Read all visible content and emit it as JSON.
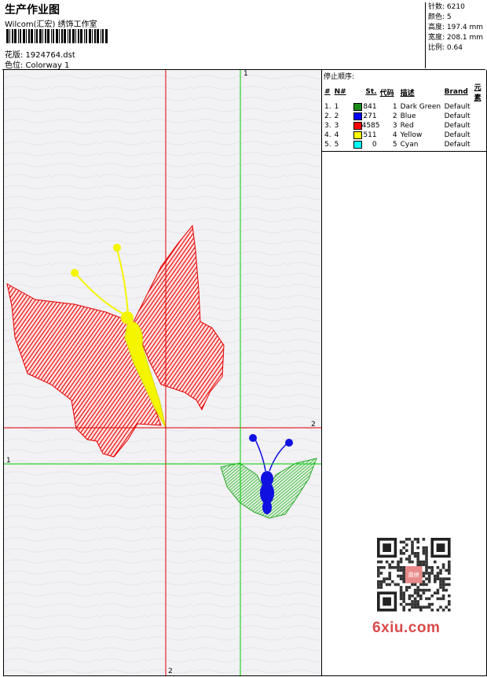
{
  "header": {
    "title": "生产作业图",
    "subtitle": "Wilcom(汇宏) 绣饰工作室",
    "design_label": "花版: 1924764.dst",
    "colorway_label": "色位: Colorway 1"
  },
  "stats": {
    "stitches": "针数: 6210",
    "colors": "颜色: 5",
    "height": "高度: 197.4 mm",
    "width": "宽度: 208.1 mm",
    "scale": "比例: 0.64"
  },
  "sequence": {
    "heading": "停止顺序:",
    "columns": [
      "#",
      "N#",
      "St.",
      "代码",
      "描述",
      "Brand",
      "元素"
    ],
    "rows": [
      {
        "num": "1.",
        "n": "1",
        "color": "#1a8c1a",
        "st": "841",
        "code": "1",
        "desc": "Dark Green",
        "brand": "Default"
      },
      {
        "num": "2.",
        "n": "2",
        "color": "#0000ff",
        "st": "271",
        "code": "2",
        "desc": "Blue",
        "brand": "Default"
      },
      {
        "num": "3.",
        "n": "3",
        "color": "#ff0000",
        "st": "4585",
        "code": "3",
        "desc": "Red",
        "brand": "Default"
      },
      {
        "num": "4.",
        "n": "4",
        "color": "#ffff00",
        "st": "511",
        "code": "4",
        "desc": "Yellow",
        "brand": "Default"
      },
      {
        "num": "5.",
        "n": "5",
        "color": "#00ffff",
        "st": "0",
        "code": "5",
        "desc": "Cyan",
        "brand": "Default"
      }
    ]
  },
  "axes": {
    "green_top": "1",
    "green_left": "1",
    "red_right": "2",
    "red_bottom": "2"
  },
  "watermark": "6xiu.com",
  "qr_badge": "鼎绣",
  "colors": {
    "red_axis": "#dd0000",
    "green_axis": "#00cc00",
    "red_fill": "#e60000",
    "yellow_fill": "#f5f500",
    "blue_fill": "#1010e0",
    "green_fill": "#2aa82a"
  }
}
